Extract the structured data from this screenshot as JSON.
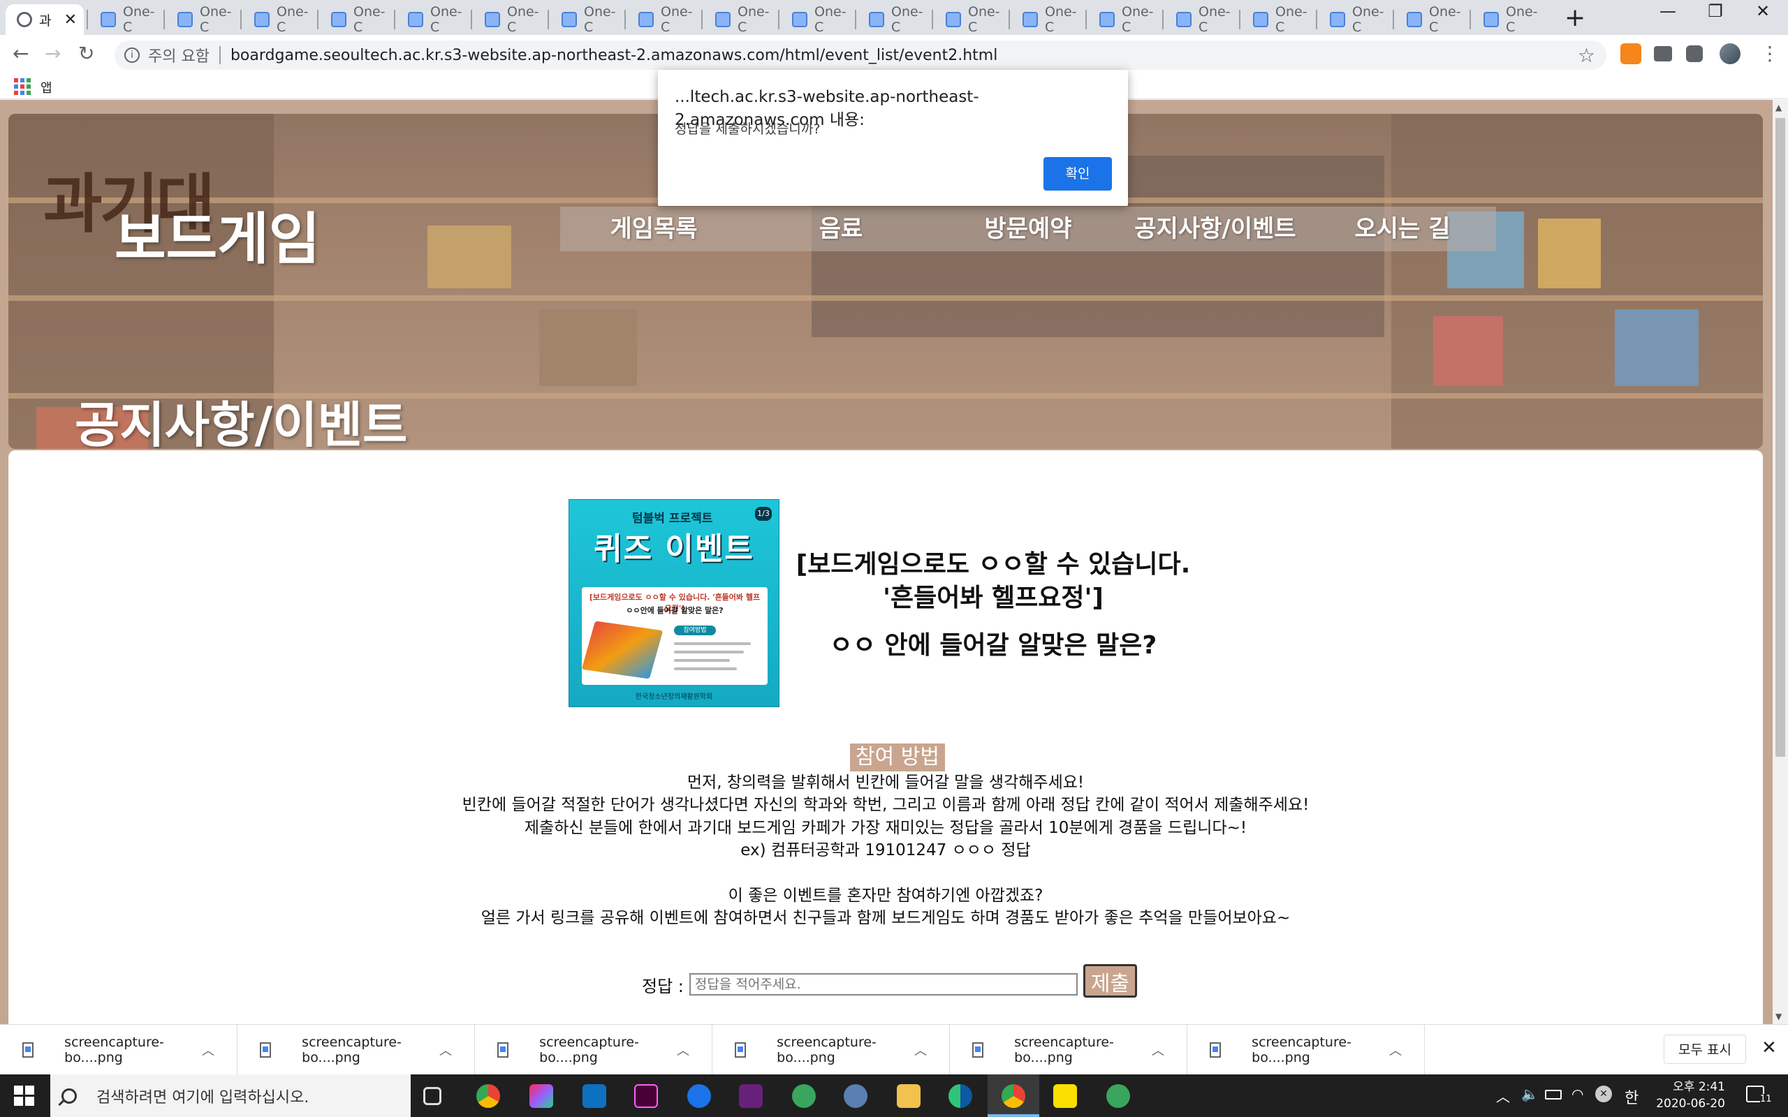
{
  "browser": {
    "active_tab_title": "과",
    "other_tab_title": "One-C",
    "other_tab_count": 19,
    "security_label": "주의 요함",
    "url": "boardgame.seoultech.ac.kr.s3-website.ap-northeast-2.amazonaws.com/html/event_list/event2.html",
    "bookmarks_apps_label": "앱"
  },
  "site": {
    "logo_small": "과기대",
    "logo_big": "보드게임",
    "nav": [
      "게임목록",
      "음료",
      "방문예약",
      "공지사항/이벤트",
      "오시는 길"
    ],
    "hero_title": "공지사항/이벤트"
  },
  "poster": {
    "top_label": "텀블벅 프로젝트",
    "page": "1/3",
    "title": "퀴즈 이벤트",
    "line1": "[보드게임으로도 ㅇㅇ할 수 있습니다. '흔들어봐 헬프요정']",
    "line2": "ㅇㅇ안에 들어갈 알맞은 말은?",
    "badge": "참여방법",
    "footer": "한국청소년정의재활원학회"
  },
  "event": {
    "question_line1": "[보드게임으로도 ㅇㅇ할 수 있습니다.",
    "question_line2": "'흔들어봐 헬프요정']",
    "question_line3": "ㅇㅇ 안에 들어갈 알맞은 말은?",
    "how_label": "참여 방법",
    "desc": [
      "먼저, 창의력을 발휘해서 빈칸에 들어갈 말을 생각해주세요!",
      "빈칸에 들어갈 적절한 단어가 생각나셨다면 자신의 학과와 학번, 그리고 이름과 함께 아래 정답 칸에 같이 적어서 제출해주세요!",
      "제출하신 분들에 한에서 과기대 보드게임 카페가 가장 재미있는 정답을 골라서 10분에게 경품을 드립니다~!",
      "ex) 컴퓨터공학과 19101247 ㅇㅇㅇ 정답",
      "",
      "이 좋은 이벤트를 혼자만 참여하기엔 아깝겠죠?",
      "얼른 가서 링크를 공유해 이벤트에 참여하면서 친구들과 함께 보드게임도 하며 경품도 받아가 좋은 추억을 만들어보아요~"
    ],
    "answer_label": "정답 :",
    "answer_placeholder": "정답을 적어주세요.",
    "submit_label": "제출"
  },
  "dialog": {
    "origin": "...ltech.ac.kr.s3-website.ap-northeast-2.amazonaws.com 내용:",
    "message": "정답을 제출하시겠습니까?",
    "ok_label": "확인"
  },
  "downloads": {
    "items": [
      "screencapture-bo....png",
      "screencapture-bo....png",
      "screencapture-bo....png",
      "screencapture-bo....png",
      "screencapture-bo....png",
      "screencapture-bo....png"
    ],
    "show_all_label": "모두 표시"
  },
  "taskbar": {
    "search_placeholder": "검색하려면 여기에 입력하십시오.",
    "ime_label": "한",
    "time": "오후 2:41",
    "date": "2020-06-20",
    "notification_count": "11"
  },
  "colors": {
    "accent": "#c9a58f",
    "page_bg": "#c4a792",
    "dialog_button": "#1a73e8"
  }
}
